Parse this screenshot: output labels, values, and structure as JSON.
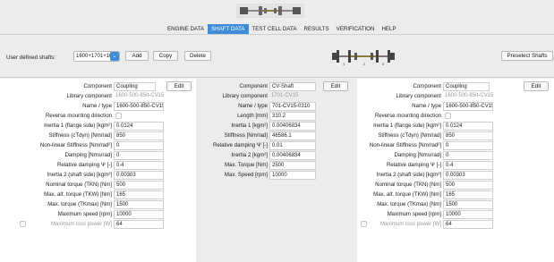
{
  "tabs": [
    {
      "label": "ENGINE DATA",
      "active": false
    },
    {
      "label": "SHAFT DATA",
      "active": true
    },
    {
      "label": "TEST CELL DATA",
      "active": false
    },
    {
      "label": "RESULTS",
      "active": false
    },
    {
      "label": "VERIFICATION",
      "active": false
    },
    {
      "label": "HELP",
      "active": false
    }
  ],
  "shafts": {
    "label": "User defined shafts:",
    "selected": "1600+1701+1600",
    "add_label": "Add",
    "copy_label": "Copy",
    "delete_label": "Delete",
    "preselect_label": "Preselect Shafts",
    "shaft_numbers": [
      "1",
      "2",
      "3"
    ]
  },
  "accent_color": "#3f8cd9",
  "left": {
    "component_label": "Component",
    "component": "Coupling",
    "edit_label": "Edit",
    "library_label": "Library component",
    "library": "1600-500-850-CV15",
    "name_label": "Name / type",
    "name": "1600-500-850-CV15",
    "reverse_label": "Reverse mounting direction",
    "inertia1_label": "Inertia 1 (flange side) [kgm²]",
    "inertia1": "0.0124",
    "stiffness_label": "Stiffness (cTdyn) [Nm/rad]",
    "stiffness": "850",
    "nonlinear_label": "Non-linear Stiffness [Nm/rad²]",
    "nonlinear": "0",
    "damping_label": "Damping [Nms/rad]",
    "damping": "0",
    "reldamp_label": "Relative damping Ψ [-]",
    "reldamp": "0.4",
    "inertia2_label": "Inertia 2 (shaft side) [kgm²]",
    "inertia2": "0.00303",
    "nominal_label": "Nominal torque (TKN) [Nm]",
    "nominal": "500",
    "maxalt_label": "Max. alt. torque (TKW) [Nm]",
    "maxalt": "165",
    "maxtorque_label": "Max. torque (TKmax) [Nm]",
    "maxtorque": "1500",
    "maxspeed_label": "Maximum speed [rpm]",
    "maxspeed": "10000",
    "maxloss_label": "Maximum loss power [W]",
    "maxloss": "64"
  },
  "middle": {
    "component_label": "Component",
    "component": "CV-Shaft",
    "edit_label": "Edit",
    "library_label": "Library component",
    "library": "1701-CV15",
    "name_label": "Name / type",
    "name": "701-CV15-0310",
    "length_label": "Length [mm]",
    "length": "310.2",
    "inertia1_label": "Inertia 1 [kgm²]",
    "inertia1": "0.00406834",
    "stiffness_label": "Stiffness [Nm/rad]",
    "stiffness": "46586.1",
    "reldamp_label": "Relative damping Ψ [-]",
    "reldamp": "0.01",
    "inertia2_label": "Inertia 2 [kgm²]",
    "inertia2": "0.00406834",
    "maxtorque_label": "Max. Torque [Nm]",
    "maxtorque": "2500",
    "maxspeed_label": "Max. Speed [rpm]",
    "maxspeed": "10000"
  },
  "right": {
    "component_label": "Component",
    "component": "Coupling",
    "edit_label": "Edit",
    "library_label": "Library component",
    "library": "1600-500-850-CV15",
    "name_label": "Name / type",
    "name": "1600-500-850-CV15",
    "reverse_label": "Reverse mounting direction",
    "inertia1_label": "Inertia 1 (flange side) [kgm²]",
    "inertia1": "0.0124",
    "stiffness_label": "Stiffness (cTdyn) [Nm/rad]",
    "stiffness": "850",
    "nonlinear_label": "Non-linear Stiffness [Nm/rad²]",
    "nonlinear": "0",
    "damping_label": "Damping [Nms/rad]",
    "damping": "0",
    "reldamp_label": "Relative damping Ψ [-]",
    "reldamp": "0.4",
    "inertia2_label": "Inertia 2 (shaft side) [kgm²]",
    "inertia2": "0.00303",
    "nominal_label": "Nominal torque (TKN) [Nm]",
    "nominal": "500",
    "maxalt_label": "Max. alt. torque (TKW) [Nm]",
    "maxalt": "165",
    "maxtorque_label": "Max. torque (TKmax) [Nm]",
    "maxtorque": "1500",
    "maxspeed_label": "Maximum speed [rpm]",
    "maxspeed": "10000",
    "maxloss_label": "Maximum loss power [W]",
    "maxloss": "64"
  }
}
